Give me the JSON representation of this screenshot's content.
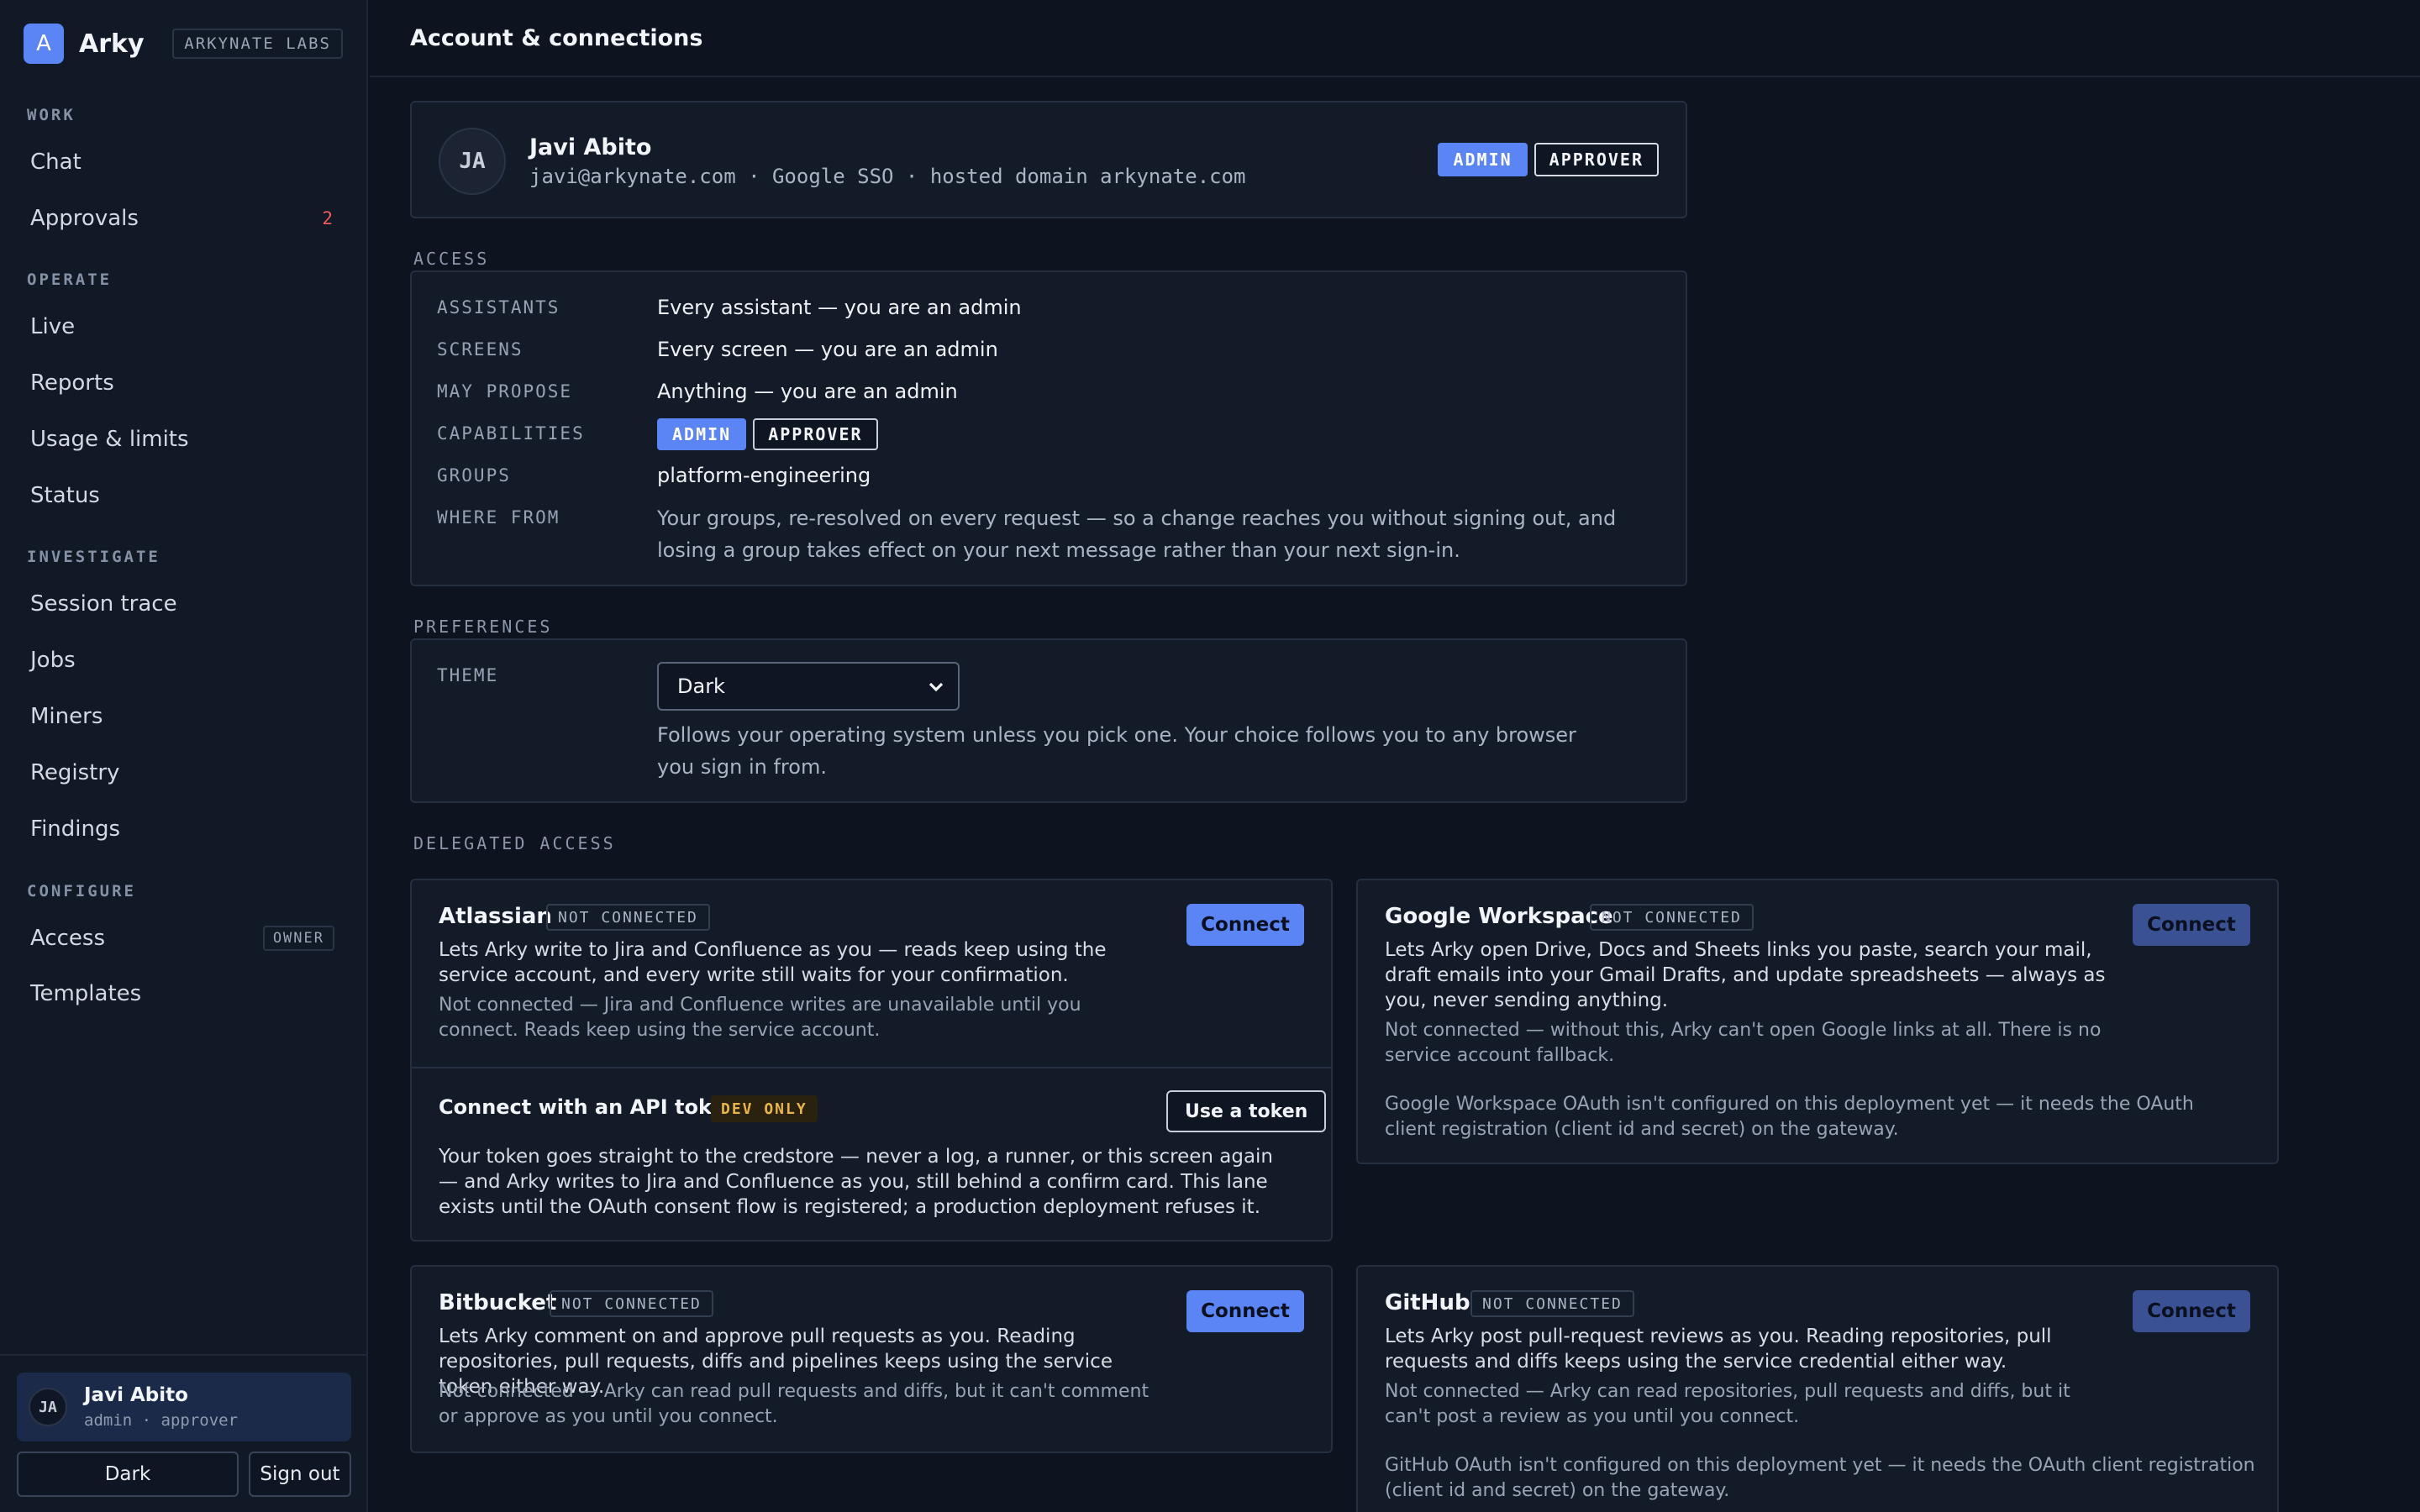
{
  "brand": {
    "logo_letter": "A",
    "name": "Arky",
    "org": "ARKYNATE LABS"
  },
  "nav": {
    "sections": {
      "work": "WORK",
      "operate": "OPERATE",
      "investigate": "INVESTIGATE",
      "configure": "CONFIGURE"
    },
    "items": {
      "chat": "Chat",
      "approvals": "Approvals",
      "approvals_badge": "2",
      "live": "Live",
      "reports": "Reports",
      "usage": "Usage & limits",
      "status": "Status",
      "session_trace": "Session trace",
      "jobs": "Jobs",
      "miners": "Miners",
      "registry": "Registry",
      "findings": "Findings",
      "access": "Access",
      "access_badge": "OWNER",
      "templates": "Templates"
    }
  },
  "user": {
    "initials": "JA",
    "name": "Javi Abito",
    "role": "admin · approver",
    "theme_button": "Dark",
    "signout_button": "Sign out"
  },
  "page": {
    "title": "Account & connections"
  },
  "profile": {
    "initials": "JA",
    "name": "Javi Abito",
    "meta": "javi@arkynate.com · Google SSO · hosted domain arkynate.com",
    "badge_admin": "ADMIN",
    "badge_approver": "APPROVER"
  },
  "access": {
    "label": "ACCESS",
    "rows": {
      "assistants_key": "ASSISTANTS",
      "assistants_val": "Every assistant — you are an admin",
      "screens_key": "SCREENS",
      "screens_val": "Every screen — you are an admin",
      "propose_key": "MAY PROPOSE",
      "propose_val": "Anything — you are an admin",
      "capabilities_key": "CAPABILITIES",
      "cap_admin": "ADMIN",
      "cap_approver": "APPROVER",
      "groups_key": "GROUPS",
      "groups_val": "platform-engineering",
      "where_key": "WHERE FROM",
      "where_val": "Your groups, re-resolved on every request — so a change reaches you without signing out, and losing a group takes effect on your next message rather than your next sign-in."
    }
  },
  "preferences": {
    "label": "PREFERENCES",
    "theme_key": "THEME",
    "theme_value": "Dark",
    "theme_desc": "Follows your operating system unless you pick one. Your choice follows you to any browser you sign in from."
  },
  "delegated": {
    "label": "DELEGATED ACCESS",
    "atlassian": {
      "name": "Atlassian",
      "status": "NOT CONNECTED",
      "desc": "Lets Arky write to Jira and Confluence as you — reads keep using the service account, and every write still waits for your confirmation.",
      "note": "Not connected — Jira and Confluence writes are unavailable until you connect. Reads keep using the service account.",
      "button": "Connect",
      "token_title": "Connect with an API token",
      "token_tag": "DEV ONLY",
      "token_button": "Use a token",
      "token_desc": "Your token goes straight to the credstore — never a log, a runner, or this screen again — and Arky writes to Jira and Confluence as you, still behind a confirm card. This lane exists until the OAuth consent flow is registered; a production deployment refuses it."
    },
    "google": {
      "name": "Google Workspace",
      "status": "NOT CONNECTED",
      "desc": "Lets Arky open Drive, Docs and Sheets links you paste, search your mail, draft emails into your Gmail Drafts, and update spreadsheets — always as you, never sending anything.",
      "note": "Not connected — without this, Arky can't open Google links at all. There is no service account fallback.",
      "config_note": "Google Workspace OAuth isn't configured on this deployment yet — it needs the OAuth client registration (client id and secret) on the gateway.",
      "button": "Connect"
    },
    "bitbucket": {
      "name": "Bitbucket",
      "status": "NOT CONNECTED",
      "desc": "Lets Arky comment on and approve pull requests as you. Reading repositories, pull requests, diffs and pipelines keeps using the service token either way.",
      "note": "Not connected — Arky can read pull requests and diffs, but it can't comment or approve as you until you connect.",
      "button": "Connect"
    },
    "github": {
      "name": "GitHub",
      "status": "NOT CONNECTED",
      "desc": "Lets Arky post pull-request reviews as you. Reading repositories, pull requests and diffs keeps using the service credential either way.",
      "note": "Not connected — Arky can read repositories, pull requests and diffs, but it can't post a review as you until you connect.",
      "config_note": "GitHub OAuth isn't configured on this deployment yet — it needs the OAuth client registration (client id and secret) on the gateway.",
      "button": "Connect"
    }
  },
  "colors": {
    "accent": "#5b84f5",
    "background": "#0d131f",
    "sidebar": "#111826",
    "card": "#141b28",
    "badge_red": "#ef5b5b",
    "dev_only": "#e9b54a"
  }
}
